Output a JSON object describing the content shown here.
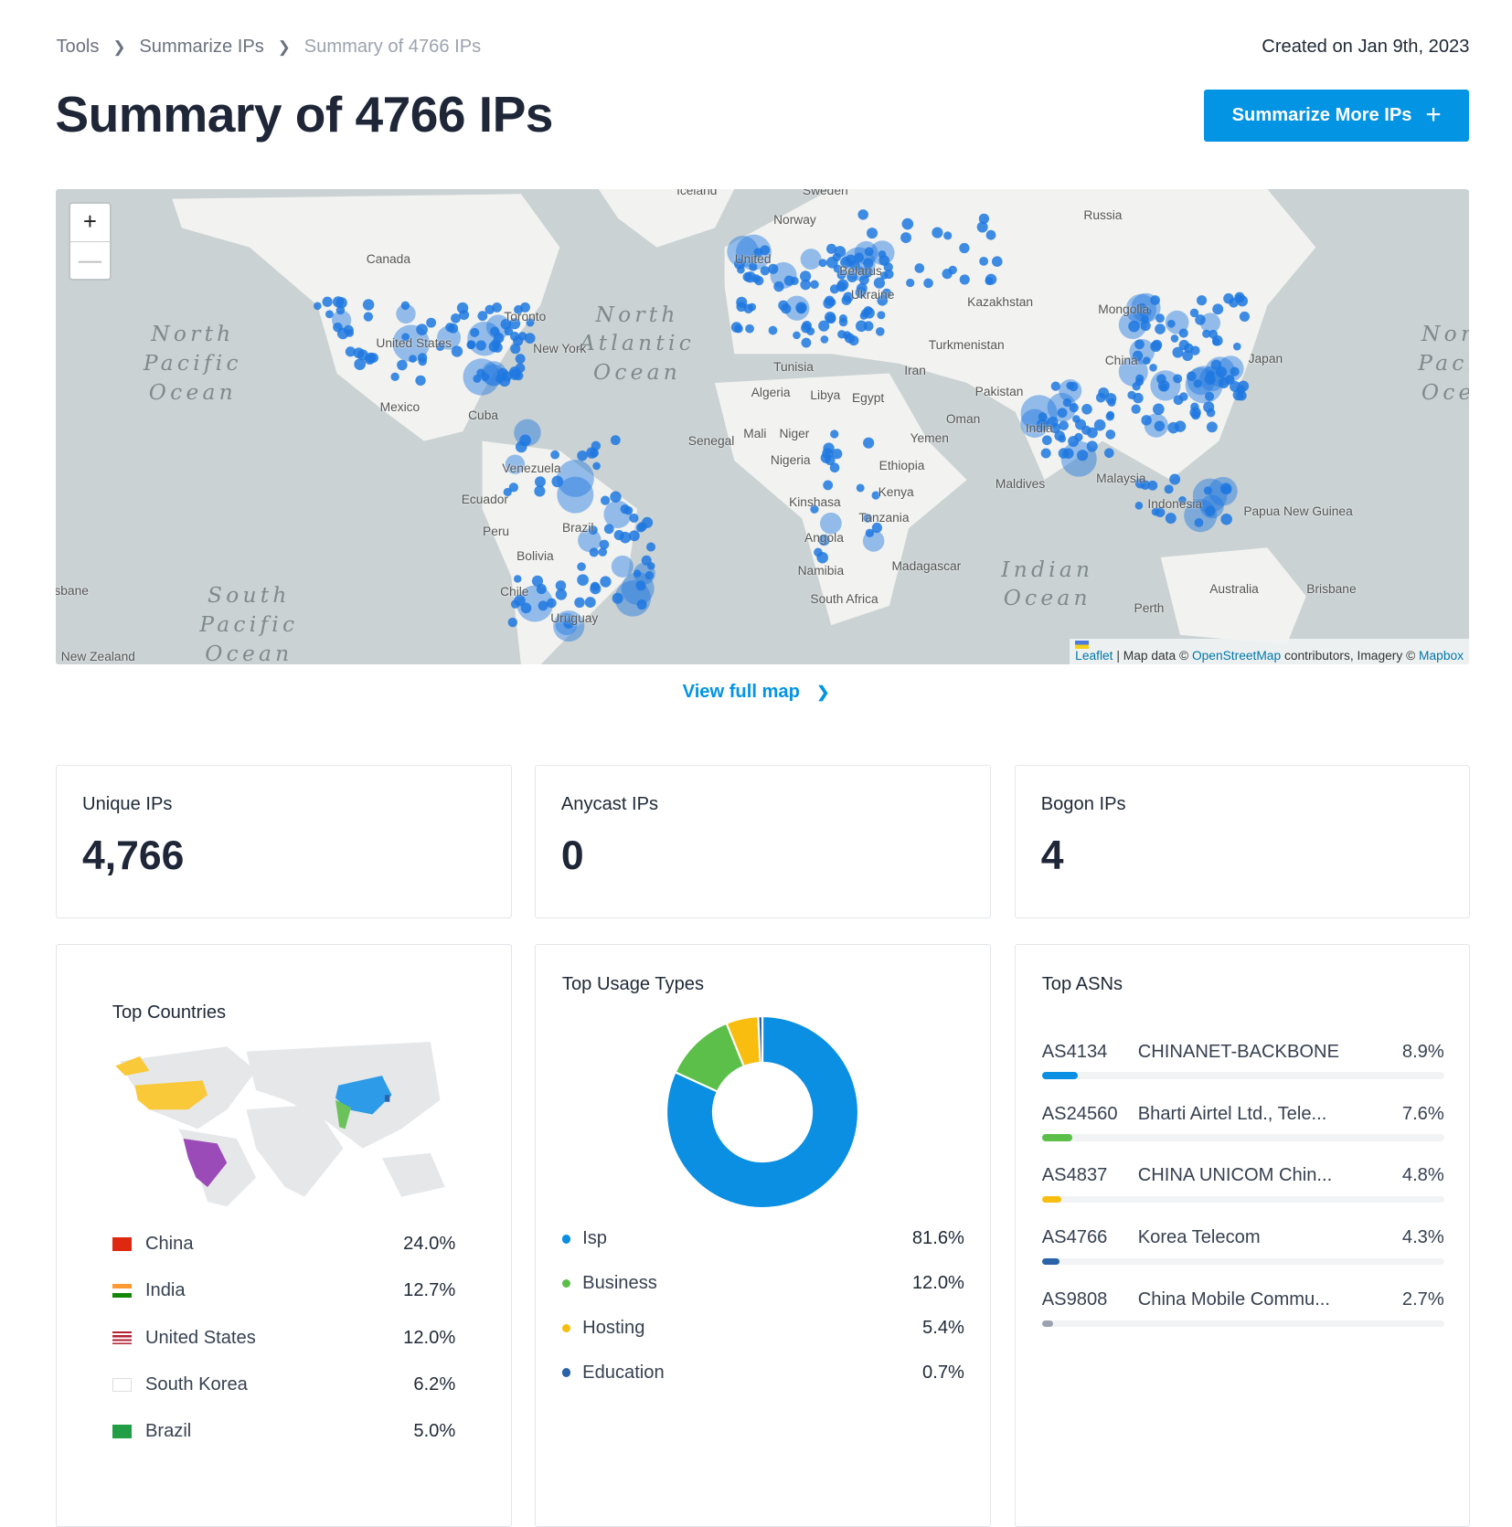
{
  "breadcrumb": [
    "Tools",
    "Summarize IPs",
    "Summary of 4766 IPs"
  ],
  "created": "Created on Jan 9th, 2023",
  "title": "Summary of 4766 IPs",
  "summarize_button": "Summarize More IPs",
  "map": {
    "zoom_in": "+",
    "zoom_out": "—",
    "oceans": [
      "North\nPacific\nOcean",
      "North\nAtlantic\nOcean",
      "Indian\nOcean",
      "South\nPacific\nOcean",
      "Nor\nPaci\nOce"
    ],
    "labels": [
      "Iceland",
      "Sweden",
      "Norway",
      "Russia",
      "Canada",
      "United",
      "Kazakhstan",
      "Mongolia",
      "Belarus",
      "Ukraine",
      "Turkmenistan",
      "China",
      "Japan",
      "United States",
      "Toronto",
      "New York",
      "Tunisia",
      "Algeria",
      "Libya",
      "Egypt",
      "Iran",
      "Pakistan",
      "Oman",
      "Mexico",
      "Cuba",
      "Mali",
      "Niger",
      "Senegal",
      "Yemen",
      "Nigeria",
      "Ethiopia",
      "India",
      "Venezuela",
      "Ecuador",
      "Kenya",
      "Kinshasa",
      "Tanzania",
      "Maldives",
      "Malaysia",
      "Indonesia",
      "Papua New Guinea",
      "Peru",
      "Brazil",
      "Bolivia",
      "Angola",
      "Namibia",
      "Madagascar",
      "South Africa",
      "Chile",
      "Uruguay",
      "Australia",
      "Perth",
      "Brisbane",
      "sbane",
      "New Zealand"
    ],
    "attribution": {
      "leaflet": "Leaflet",
      "text1": " | Map data © ",
      "osm": "OpenStreetMap",
      "text2": " contributors, Imagery © ",
      "mapbox": "Mapbox"
    },
    "dot_color": "#1f78e0"
  },
  "view_full_map": "View full map",
  "stats": [
    {
      "label": "Unique IPs",
      "value": "4,766"
    },
    {
      "label": "Anycast IPs",
      "value": "0"
    },
    {
      "label": "Bogon IPs",
      "value": "4"
    }
  ],
  "top_countries": {
    "title": "Top Countries",
    "items": [
      {
        "name": "China",
        "pct": "24.0%",
        "map_color": "#2d9be8"
      },
      {
        "name": "India",
        "pct": "12.7%",
        "map_color": "#6cc25a"
      },
      {
        "name": "United States",
        "pct": "12.0%",
        "map_color": "#f9c93a"
      },
      {
        "name": "South Korea",
        "pct": "6.2%",
        "map_color": "#2a63a8"
      },
      {
        "name": "Brazil",
        "pct": "5.0%",
        "map_color": "#9b4bb8"
      }
    ]
  },
  "top_usage": {
    "title": "Top Usage Types",
    "items": [
      {
        "name": "Isp",
        "pct": "81.6%",
        "value": 81.6,
        "color": "#0a8fe3"
      },
      {
        "name": "Business",
        "pct": "12.0%",
        "value": 12.0,
        "color": "#5bbf4a"
      },
      {
        "name": "Hosting",
        "pct": "5.4%",
        "value": 5.4,
        "color": "#f8bd0e"
      },
      {
        "name": "Education",
        "pct": "0.7%",
        "value": 0.7,
        "color": "#2a63a8"
      }
    ]
  },
  "top_asns": {
    "title": "Top ASNs",
    "items": [
      {
        "asn": "AS4134",
        "name": "CHINANET-BACKBONE",
        "pct": "8.9%",
        "value": 8.9,
        "color": "#0a8fe3"
      },
      {
        "asn": "AS24560",
        "name": "Bharti Airtel Ltd., Tele...",
        "pct": "7.6%",
        "value": 7.6,
        "color": "#5bbf4a"
      },
      {
        "asn": "AS4837",
        "name": "CHINA UNICOM Chin...",
        "pct": "4.8%",
        "value": 4.8,
        "color": "#f8bd0e"
      },
      {
        "asn": "AS4766",
        "name": "Korea Telecom",
        "pct": "4.3%",
        "value": 4.3,
        "color": "#2a63a8"
      },
      {
        "asn": "AS9808",
        "name": "China Mobile Commu...",
        "pct": "2.7%",
        "value": 2.7,
        "color": "#9ca3af"
      }
    ]
  }
}
